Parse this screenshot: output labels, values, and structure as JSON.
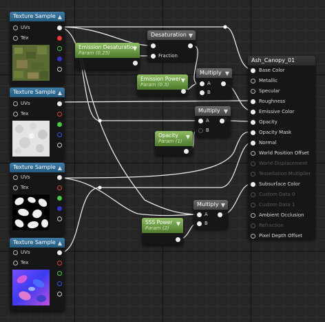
{
  "texture_samples": [
    {
      "title": "Texture Sample",
      "inputs": [
        "UVs",
        "Tex"
      ],
      "preview": "grass-texture"
    },
    {
      "title": "Texture Sample",
      "inputs": [
        "UVs",
        "Tex"
      ],
      "preview": "white-noise-texture"
    },
    {
      "title": "Texture Sample",
      "inputs": [
        "UVs",
        "Tex"
      ],
      "preview": "leaf-mask-texture"
    },
    {
      "title": "Texture Sample",
      "inputs": [
        "UVs",
        "Tex"
      ],
      "preview": "normal-map-texture"
    }
  ],
  "params": {
    "emission_desaturation": {
      "title": "Emission Desaturation",
      "sub": "Param (0.25)"
    },
    "emission_power": {
      "title": "Emission Power",
      "sub": "Param (0.3)"
    },
    "opacity": {
      "title": "Opacity",
      "sub": "Param (1)"
    },
    "sss_power": {
      "title": "SSS Power",
      "sub": "Param (2)"
    }
  },
  "desaturation": {
    "title": "Desaturation",
    "inputs": [
      "",
      "Fraction"
    ]
  },
  "multiply_nodes": [
    {
      "title": "Multiply",
      "inputs": [
        "A",
        "B"
      ]
    },
    {
      "title": "Multiply",
      "inputs": [
        "A",
        "B"
      ]
    },
    {
      "title": "Multiply",
      "inputs": [
        "A",
        "B"
      ]
    }
  ],
  "material": {
    "title": "Ash_Canopy_01",
    "inputs": [
      {
        "label": "Base Color",
        "active": true,
        "connected": true
      },
      {
        "label": "Metallic",
        "active": true,
        "connected": false
      },
      {
        "label": "Specular",
        "active": true,
        "connected": false
      },
      {
        "label": "Roughness",
        "active": true,
        "connected": true
      },
      {
        "label": "Emissive Color",
        "active": true,
        "connected": true
      },
      {
        "label": "Opacity",
        "active": true,
        "connected": true
      },
      {
        "label": "Opacity Mask",
        "active": true,
        "connected": true
      },
      {
        "label": "Normal",
        "active": true,
        "connected": true
      },
      {
        "label": "World Position Offset",
        "active": true,
        "connected": false
      },
      {
        "label": "World Displacement",
        "active": false,
        "connected": false
      },
      {
        "label": "Tessellation Multiplier",
        "active": false,
        "connected": false
      },
      {
        "label": "Subsurface Color",
        "active": true,
        "connected": true
      },
      {
        "label": "Custom Data 0",
        "active": false,
        "connected": false
      },
      {
        "label": "Custom Data 1",
        "active": false,
        "connected": false
      },
      {
        "label": "Ambient Occlusion",
        "active": true,
        "connected": false
      },
      {
        "label": "Refraction",
        "active": false,
        "connected": false
      },
      {
        "label": "Pixel Depth Offset",
        "active": true,
        "connected": false
      }
    ]
  },
  "colors": {
    "blue_header": "#3e7da7",
    "param_green": "#8fbd62",
    "wire": "#e8e8e8"
  }
}
